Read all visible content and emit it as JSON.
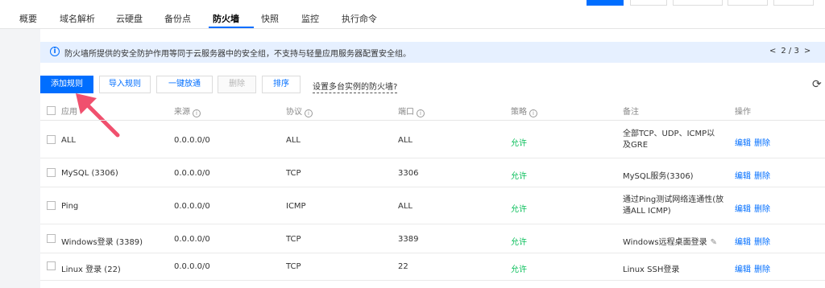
{
  "tabs": [
    "概要",
    "域名解析",
    "云硬盘",
    "备份点",
    "防火墙",
    "快照",
    "监控",
    "执行命令"
  ],
  "active_tab": "防火墙",
  "notice": {
    "text": "防火墙所提供的安全防护作用等同于云服务器中的安全组，不支持与轻量应用服务器配置安全组。",
    "pager_prev": "<",
    "pager_text": "2 / 3",
    "pager_next": ">"
  },
  "toolbar": {
    "add_rule": "添加规则",
    "import_rules": "导入规则",
    "one_click_allow": "一键放通",
    "delete": "删除",
    "sort": "排序",
    "multi_instance_link": "设置多台实例的防火墙?"
  },
  "columns": {
    "app": "应用",
    "source": "来源",
    "protocol": "协议",
    "port": "端口",
    "policy": "策略",
    "note": "备注",
    "ops": "操作"
  },
  "rows": [
    {
      "app": "ALL",
      "source": "0.0.0.0/0",
      "protocol": "ALL",
      "port": "ALL",
      "policy": "允许",
      "note": "全部TCP、UDP、ICMP以及GRE",
      "edit": "编辑",
      "delete": "删除"
    },
    {
      "app": "MySQL (3306)",
      "source": "0.0.0.0/0",
      "protocol": "TCP",
      "port": "3306",
      "policy": "允许",
      "note": "MySQL服务(3306)",
      "edit": "编辑",
      "delete": "删除"
    },
    {
      "app": "Ping",
      "source": "0.0.0.0/0",
      "protocol": "ICMP",
      "port": "ALL",
      "policy": "允许",
      "note": "通过Ping测试网络连通性(放通ALL ICMP)",
      "edit": "编辑",
      "delete": "删除"
    },
    {
      "app": "Windows登录 (3389)",
      "source": "0.0.0.0/0",
      "protocol": "TCP",
      "port": "3389",
      "policy": "允许",
      "note": "Windows远程桌面登录",
      "edit": "编辑",
      "delete": "删除"
    },
    {
      "app": "Linux 登录 (22)",
      "source": "0.0.0.0/0",
      "protocol": "TCP",
      "port": "22",
      "policy": "允许",
      "note": "Linux SSH登录",
      "edit": "编辑",
      "delete": "删除"
    }
  ],
  "colors": {
    "primary": "#006eff",
    "allow": "#0abf5b",
    "notice_bg": "#e6f0ff",
    "arrow": "#f0506e"
  }
}
